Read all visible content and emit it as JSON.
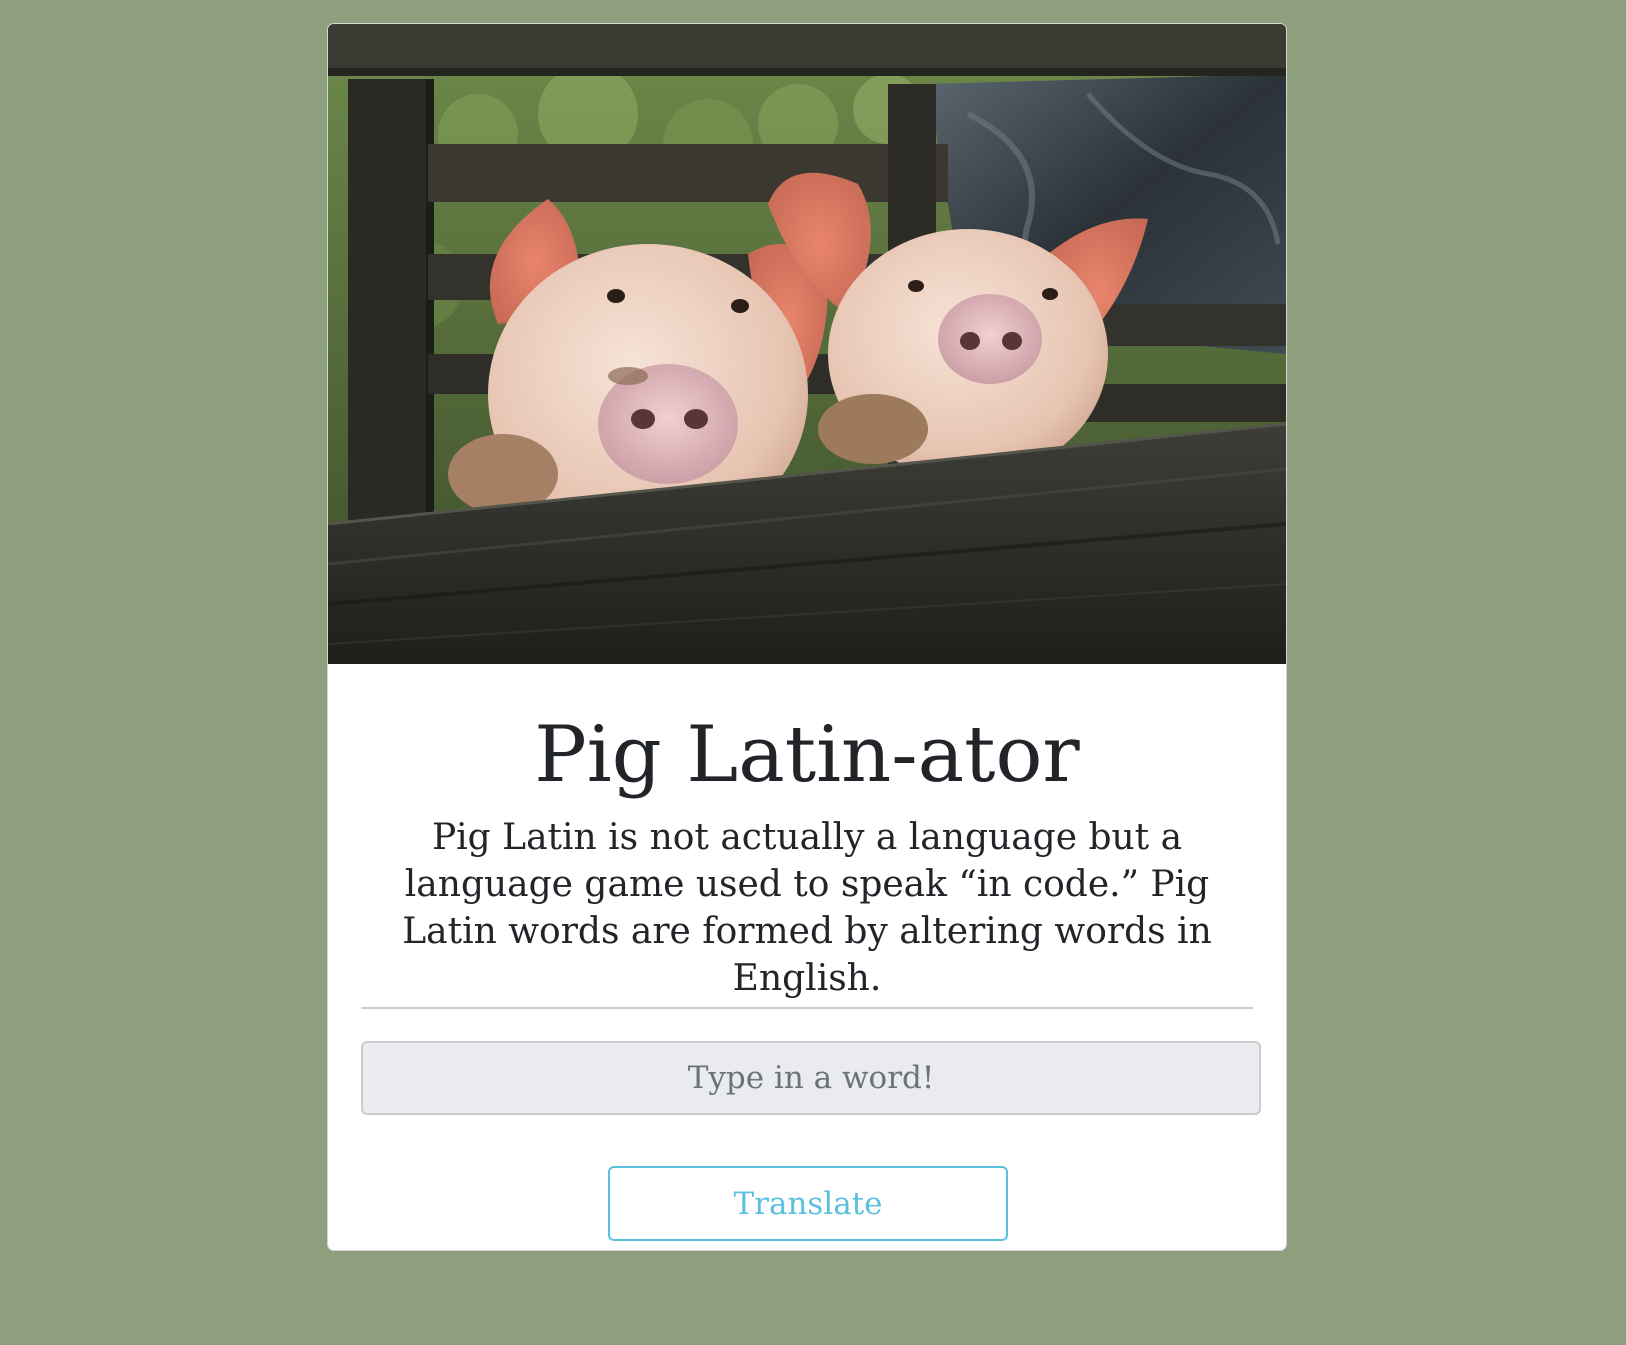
{
  "header": {
    "title": "Pig Latin-ator",
    "description": "Pig Latin is not actually a language but a language game used to speak “in code.” Pig Latin words are formed by altering words in English."
  },
  "hero_image": {
    "subject": "two pigs looking over a wooden fence"
  },
  "form": {
    "input_placeholder": "Type in a word!",
    "input_value": "",
    "button_label": "Translate"
  },
  "colors": {
    "page_background": "#8d9f7c",
    "card_background": "#ffffff",
    "button_accent": "#5bc0de",
    "input_background": "#eaebee",
    "text": "#212529"
  }
}
